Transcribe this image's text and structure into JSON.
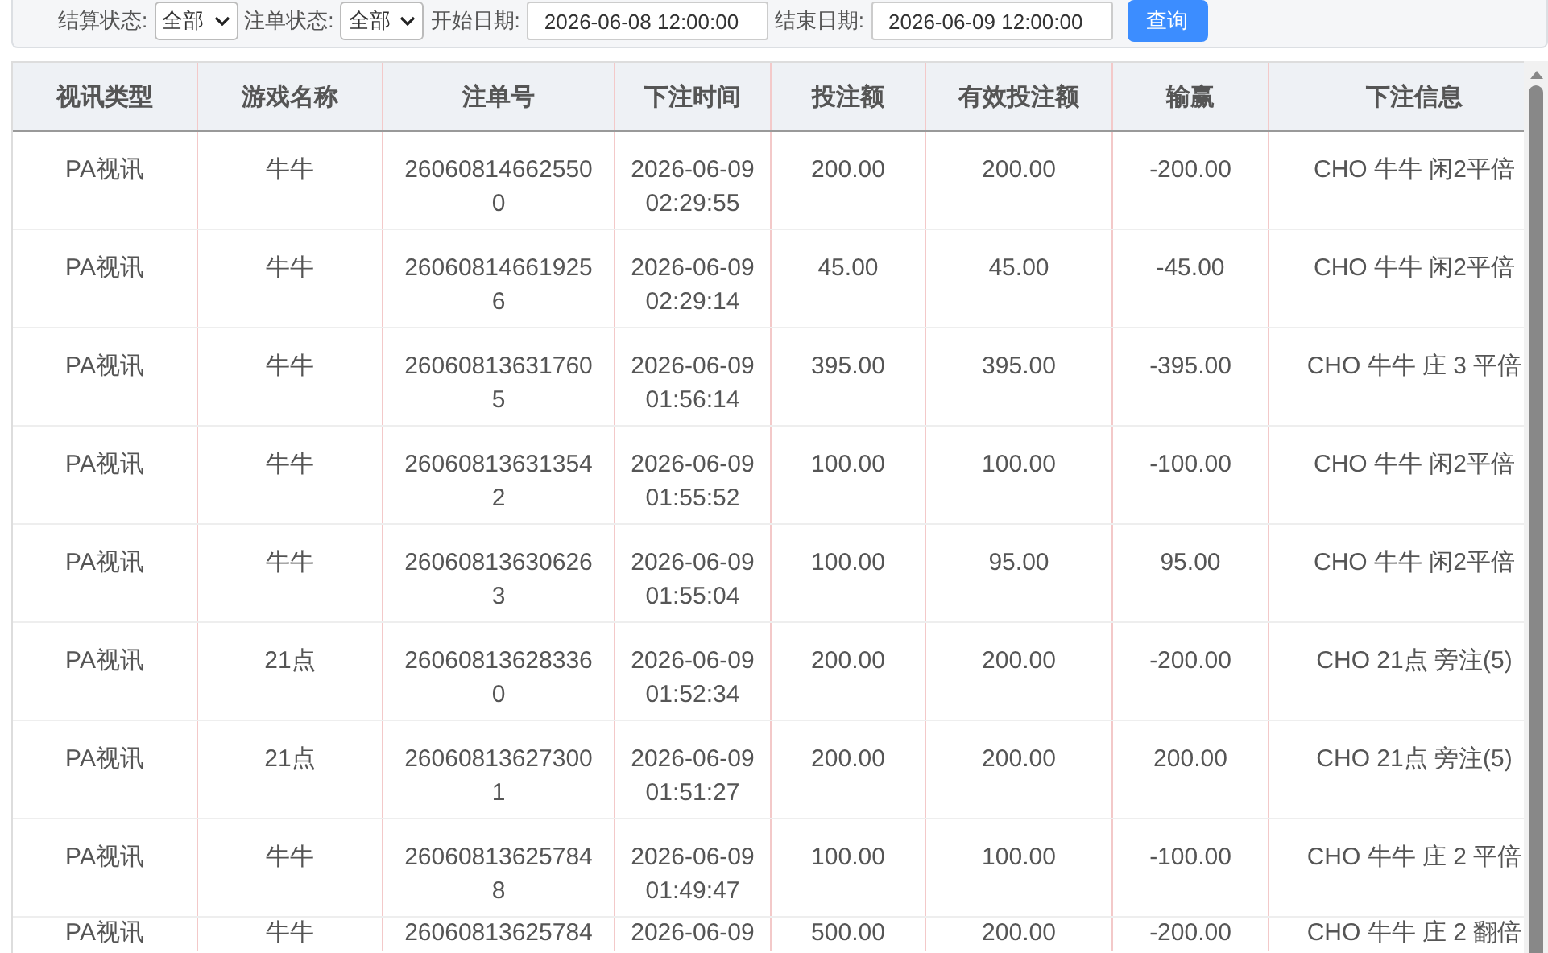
{
  "filters": {
    "settle_status": {
      "label": "结算状态:",
      "value": "全部"
    },
    "order_status": {
      "label": "注单状态:",
      "value": "全部"
    },
    "start_date": {
      "label": "开始日期:",
      "value": "2026-06-08 12:00:00"
    },
    "end_date": {
      "label": "结束日期:",
      "value": "2026-06-09 12:00:00"
    },
    "search_button": "查询"
  },
  "table": {
    "columns": [
      "视讯类型",
      "游戏名称",
      "注单号",
      "下注时间",
      "投注额",
      "有效投注额",
      "输赢",
      "下注信息"
    ],
    "rows": [
      [
        "PA视讯",
        "牛牛",
        "260608146625500",
        "2026-06-09 02:29:55",
        "200.00",
        "200.00",
        "-200.00",
        "CHO 牛牛 闲2平倍"
      ],
      [
        "PA视讯",
        "牛牛",
        "260608146619256",
        "2026-06-09 02:29:14",
        "45.00",
        "45.00",
        "-45.00",
        "CHO 牛牛 闲2平倍"
      ],
      [
        "PA视讯",
        "牛牛",
        "260608136317605",
        "2026-06-09 01:56:14",
        "395.00",
        "395.00",
        "-395.00",
        "CHO 牛牛 庄 3 平倍"
      ],
      [
        "PA视讯",
        "牛牛",
        "260608136313542",
        "2026-06-09 01:55:52",
        "100.00",
        "100.00",
        "-100.00",
        "CHO 牛牛 闲2平倍"
      ],
      [
        "PA视讯",
        "牛牛",
        "260608136306263",
        "2026-06-09 01:55:04",
        "100.00",
        "95.00",
        "95.00",
        "CHO 牛牛 闲2平倍"
      ],
      [
        "PA视讯",
        "21点",
        "260608136283360",
        "2026-06-09 01:52:34",
        "200.00",
        "200.00",
        "-200.00",
        "CHO 21点 旁注(5)"
      ],
      [
        "PA视讯",
        "21点",
        "260608136273001",
        "2026-06-09 01:51:27",
        "200.00",
        "200.00",
        "200.00",
        "CHO 21点 旁注(5)"
      ],
      [
        "PA视讯",
        "牛牛",
        "260608136257848",
        "2026-06-09 01:49:47",
        "100.00",
        "100.00",
        "-100.00",
        "CHO 牛牛 庄 2 平倍"
      ],
      [
        "PA视讯",
        "牛牛",
        "26060813625784",
        "2026-06-09",
        "500.00",
        "200.00",
        "-200.00",
        "CHO 牛牛 庄 2 翻倍"
      ]
    ]
  }
}
